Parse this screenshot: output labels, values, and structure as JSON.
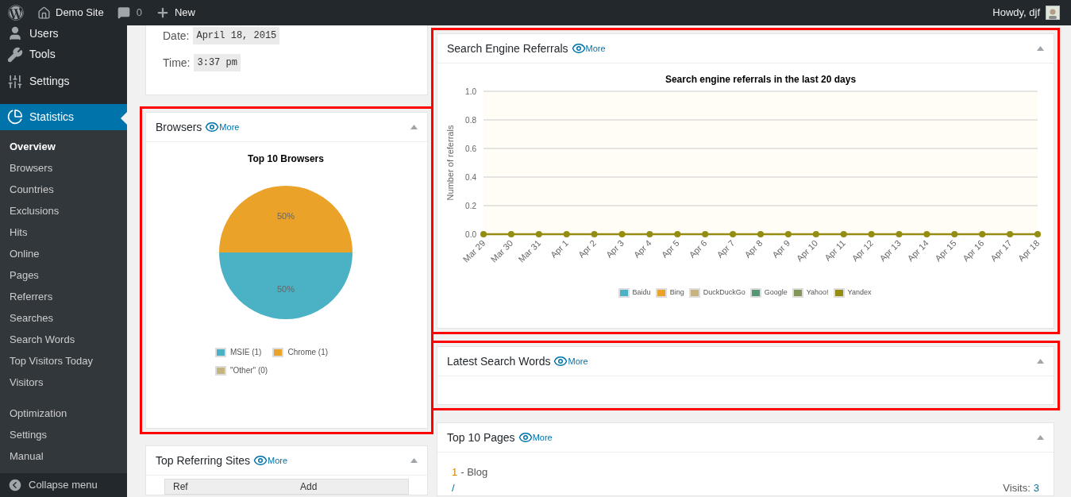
{
  "top_bar": {
    "site_name": "Demo Site",
    "comments_count": "0",
    "new_label": "New",
    "greeting": "Howdy, djf"
  },
  "sidebar": {
    "items": [
      {
        "label": "Users",
        "selected": false
      },
      {
        "label": "Tools",
        "selected": false
      },
      {
        "label": "Settings",
        "selected": false
      },
      {
        "label": "Statistics",
        "selected": true
      }
    ],
    "submenu": [
      {
        "items": [
          {
            "label": "Overview",
            "selected": true
          },
          {
            "label": "Browsers",
            "selected": false
          },
          {
            "label": "Countries",
            "selected": false
          },
          {
            "label": "Exclusions",
            "selected": false
          },
          {
            "label": "Hits",
            "selected": false
          },
          {
            "label": "Online",
            "selected": false
          },
          {
            "label": "Pages",
            "selected": false
          },
          {
            "label": "Referrers",
            "selected": false
          },
          {
            "label": "Searches",
            "selected": false
          },
          {
            "label": "Search Words",
            "selected": false
          },
          {
            "label": "Top Visitors Today",
            "selected": false
          },
          {
            "label": "Visitors",
            "selected": false
          }
        ]
      },
      {
        "items": [
          {
            "label": "Optimization",
            "selected": false
          },
          {
            "label": "Settings",
            "selected": false
          },
          {
            "label": "Manual",
            "selected": false
          }
        ]
      }
    ],
    "collapse_label": "Collapse menu"
  },
  "left_column": {
    "summary": {
      "date_label": "Date:",
      "date_value": "April 18, 2015",
      "time_label": "Time:",
      "time_value": "3:37 pm"
    },
    "browsers": {
      "title": "Browsers",
      "more": "More",
      "highlighted": true,
      "chart_data": {
        "type": "pie",
        "title": "Top 10 Browsers",
        "categories": [
          "MSIE (1)",
          "Chrome (1)",
          "\"Other\" (0)"
        ],
        "values": [
          0.5,
          0.5,
          0
        ],
        "value_labels": [
          "50%",
          "50%",
          null
        ],
        "legend": true
      },
      "legend": [
        {
          "color": "#4bb2c5"
        },
        {
          "color": "#eaa228"
        },
        {
          "color": "#c5b47f"
        }
      ]
    },
    "top_referring_sites": {
      "title": "Top Referring Sites",
      "more": "More",
      "highlighted": false,
      "columns": [
        "Ref",
        "Add"
      ]
    }
  },
  "right_column": {
    "search_engine_referrals": {
      "title": "Search Engine Referrals",
      "more": "More",
      "highlighted": true,
      "chart_data": {
        "type": "line",
        "title": "Search engine referrals in the last 20 days",
        "ylabel": "Number of referrals",
        "grid": true,
        "legend": true,
        "categories": [
          "Mar 29",
          "Mar 30",
          "Mar 31",
          "Apr 1",
          "Apr 2",
          "Apr 3",
          "Apr 4",
          "Apr 5",
          "Apr 6",
          "Apr 7",
          "Apr 8",
          "Apr 9",
          "Apr 10",
          "Apr 11",
          "Apr 12",
          "Apr 13",
          "Apr 14",
          "Apr 15",
          "Apr 16",
          "Apr 17",
          "Apr 18"
        ],
        "ylim": [
          0,
          1
        ],
        "yticks": [
          {
            "value": 0,
            "label": "0.0"
          },
          {
            "value": 0.2,
            "label": "0.2"
          },
          {
            "value": 0.4,
            "label": "0.4"
          },
          {
            "value": 0.6,
            "label": "0.6"
          },
          {
            "value": 0.8,
            "label": "0.8"
          },
          {
            "value": 1,
            "label": "1.0"
          }
        ],
        "series": [
          {
            "name": "Baidu",
            "color": "#4bb2c5",
            "values": [
              null,
              null,
              null,
              null,
              null,
              null,
              null,
              null,
              null,
              null,
              null,
              null,
              null,
              null,
              null,
              null,
              null,
              null,
              null,
              null,
              null
            ]
          },
          {
            "name": "Bing",
            "color": "#eaa228",
            "values": [
              null,
              null,
              null,
              null,
              null,
              null,
              null,
              null,
              null,
              null,
              null,
              null,
              null,
              null,
              null,
              null,
              null,
              null,
              null,
              null,
              null
            ]
          },
          {
            "name": "DuckDuckGo",
            "color": "#c5b47f",
            "values": [
              null,
              null,
              null,
              null,
              null,
              null,
              null,
              null,
              null,
              null,
              null,
              null,
              null,
              null,
              null,
              null,
              null,
              null,
              null,
              null,
              null
            ]
          },
          {
            "name": "Google",
            "color": "#579575",
            "values": [
              null,
              null,
              null,
              null,
              null,
              null,
              null,
              null,
              null,
              null,
              null,
              null,
              null,
              null,
              null,
              null,
              null,
              null,
              null,
              null,
              null
            ]
          },
          {
            "name": "Yahoo!",
            "color": "#839557",
            "values": [
              null,
              null,
              null,
              null,
              null,
              null,
              null,
              null,
              null,
              null,
              null,
              null,
              null,
              null,
              null,
              null,
              null,
              null,
              null,
              null,
              null
            ]
          },
          {
            "name": "Yandex",
            "color": "#958c12",
            "marker": "circle",
            "values": [
              0,
              0,
              0,
              0,
              0,
              0,
              0,
              0,
              0,
              0,
              0,
              0,
              0,
              0,
              0,
              0,
              0,
              0,
              0,
              0,
              0
            ]
          }
        ]
      }
    },
    "latest_search_words": {
      "title": "Latest Search Words",
      "more": "More",
      "highlighted": true
    },
    "top_pages": {
      "title": "Top 10 Pages",
      "more": "More",
      "highlighted": false,
      "rows": [
        {
          "rank": "1",
          "label": "- Blog",
          "url": "/",
          "visits_label": "Visits:",
          "visits": "3"
        }
      ]
    }
  }
}
